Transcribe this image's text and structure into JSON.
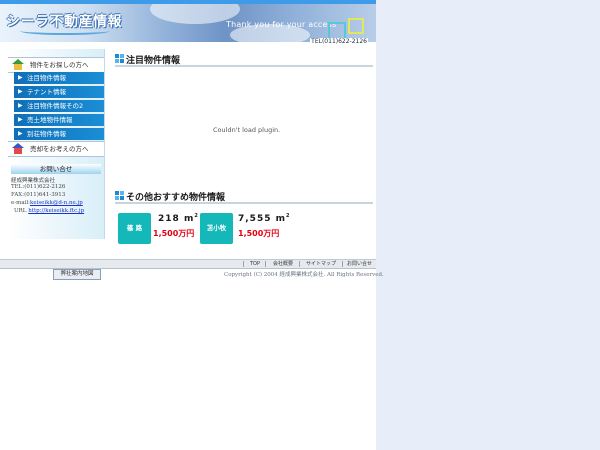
{
  "header": {
    "brand": "シーラ不動産情報",
    "tagline": "Thank you for your access",
    "tel": "TEL(011)622-2126"
  },
  "sidebar": {
    "search_heading": "物件をお探しの方へ",
    "items": [
      {
        "label": "注目物件情報"
      },
      {
        "label": "テナント情報"
      },
      {
        "label": "注目物件情報その2"
      },
      {
        "label": "売土地物件情報"
      },
      {
        "label": "別荘物件情報"
      }
    ],
    "sell_heading": "売却をお考えの方へ",
    "contact": {
      "title": "お問い合せ",
      "company": "経成興業株式会社",
      "tel": "TEL:(011)622-2126",
      "fax": "FAX:(011)641-3913",
      "email_label": "e-mail:",
      "email": "keiseikk@d-n.ne.jp",
      "url_label": "URL",
      "url": "http://keiseikk.ftc.jp",
      "map_button": "弊社案内地図"
    }
  },
  "main": {
    "featured_title": "注目物件情報",
    "plugin_message": "Couldn't load plugin.",
    "recommend_title": "その他おすすめ物件情報",
    "cards": [
      {
        "location": "篠 路",
        "area": "218",
        "unit": "m",
        "unit_sup": "2",
        "price": "1,500万円"
      },
      {
        "location": "苫小牧",
        "area": "7,555",
        "unit": "m",
        "unit_sup": "2",
        "price": "1,500万円"
      }
    ]
  },
  "footer": {
    "links": [
      "TOP",
      "会社概要",
      "サイトマップ",
      "お問い合せ"
    ],
    "copyright": "Copyright (C) 2004 経成興業株式会社. All Rights Reserved."
  },
  "colors": {
    "nav_blue": "#1a8ed6",
    "badge_teal": "#14b8b8",
    "price_red": "#e60012",
    "link_blue": "#1a35c8"
  }
}
